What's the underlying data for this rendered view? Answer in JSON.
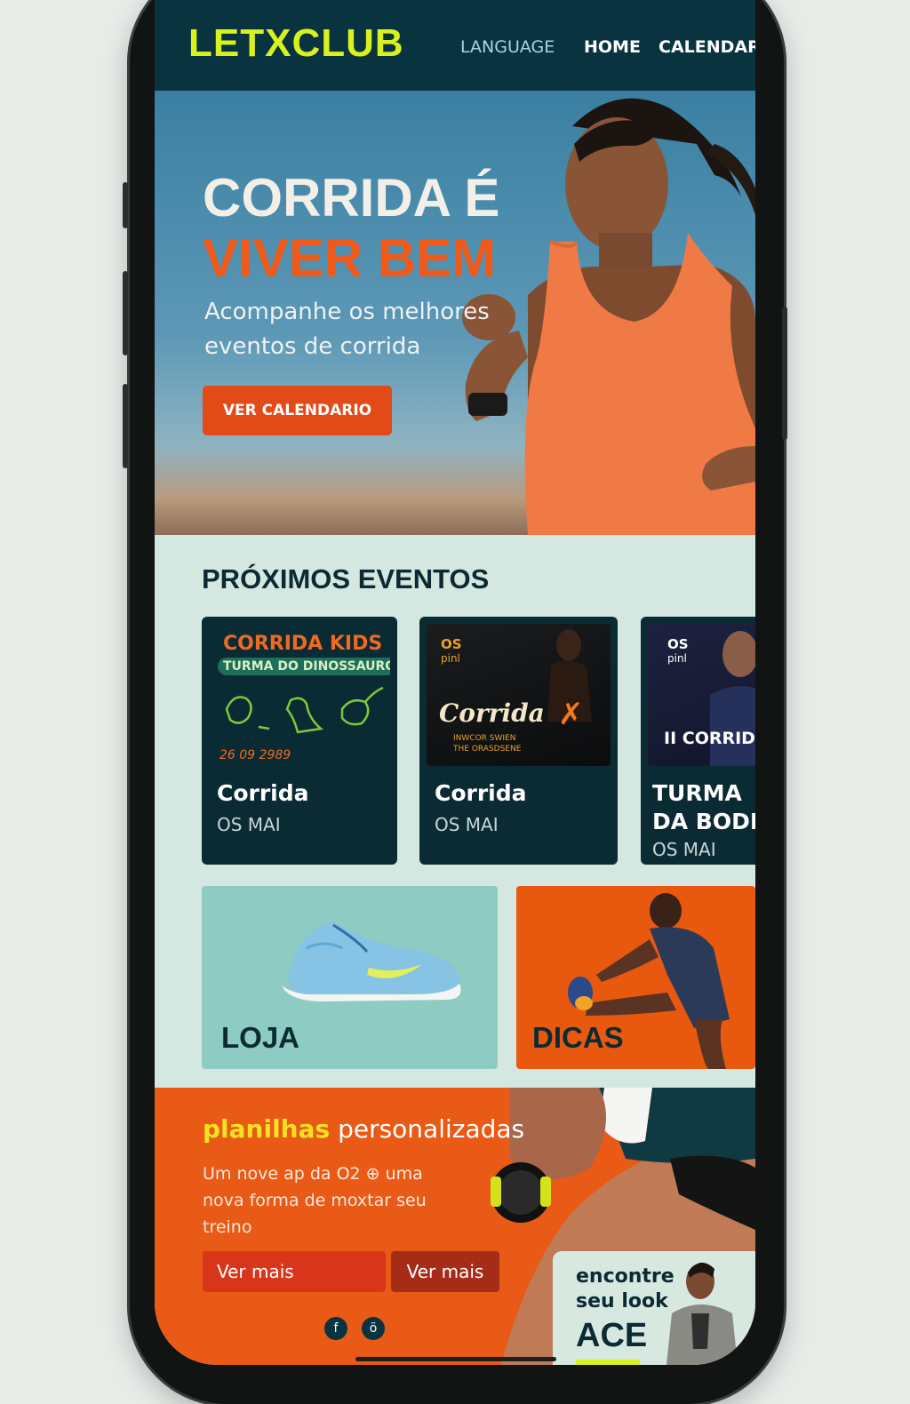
{
  "brand": {
    "logo": "LETXCLUB"
  },
  "nav": {
    "language": "LANGUAGE",
    "home": "HOME",
    "calendar": "CALENDARI"
  },
  "hero": {
    "title_line1": "CORRIDA É",
    "title_line2": "VIVER BEM",
    "subtitle": "Acompanhe os melhores eventos de corrida",
    "cta": "VER CALENDARIO"
  },
  "events": {
    "heading": "PRÓXIMOS EVENTOS",
    "items": [
      {
        "poster_title": "CORRIDA KIDS",
        "poster_tag": "TURMA DO DINOSSAURO",
        "poster_date": "26 09 2989",
        "title": "Corrida",
        "date": "OS MAI"
      },
      {
        "poster_corner": "OS",
        "poster_corner2": "pinl",
        "poster_title": "Corrida",
        "poster_sub1": "INWCOR SWIEN",
        "poster_sub2": "THE ORASDSENE",
        "title": "Corrida",
        "date": "OS MAI"
      },
      {
        "poster_corner": "OS",
        "poster_corner2": "pinl",
        "poster_title": "II CORRID",
        "title_line1": "TURMA",
        "title_line2": "DA BODIA",
        "date": "OS MAI"
      }
    ]
  },
  "tiles": {
    "shop": "LOJA",
    "tips": "DICAS"
  },
  "promo": {
    "title_highlight": "planilhas",
    "title_rest": "personalizadas",
    "text": "Um nove ap da O2 ⊕ uma nova forma de moxtar seu treino",
    "button1": "Ver mais",
    "button2": "Ver mais",
    "social": [
      "f",
      "ö"
    ]
  },
  "look": {
    "line1": "encontre",
    "line2": "seu look",
    "brand": "ACE"
  },
  "colors": {
    "nav_bg": "#0a3340",
    "logo": "#d9f21d",
    "accent_orange": "#e24a17",
    "card_bg": "#0b2b34",
    "shop_tile": "#8ecbc2",
    "tips_tile": "#e8590f",
    "highlight_yellow": "#f3e224"
  }
}
